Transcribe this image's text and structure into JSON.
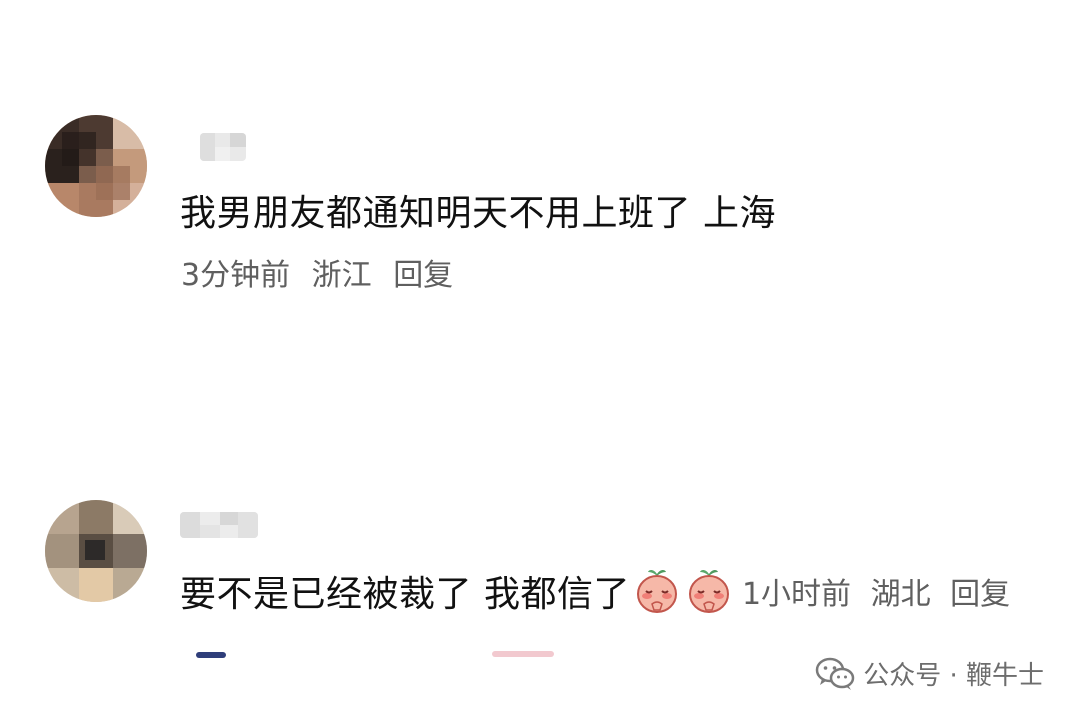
{
  "comments": [
    {
      "text": "我男朋友都通知明天不用上班了 上海",
      "time": "3分钟前",
      "location": "浙江",
      "reply_label": "回复"
    },
    {
      "text": "要不是已经被裁了 我都信了",
      "emoji": [
        "peach-praying-emoji",
        "peach-praying-emoji"
      ],
      "time": "1小时前",
      "location": "湖北",
      "reply_label": "回复"
    }
  ],
  "watermark": {
    "icon": "wechat-icon",
    "text": "公众号 · 鞭牛士"
  },
  "colors": {
    "text_primary": "#111111",
    "text_meta": "#5f5f5f",
    "background": "#ffffff"
  }
}
